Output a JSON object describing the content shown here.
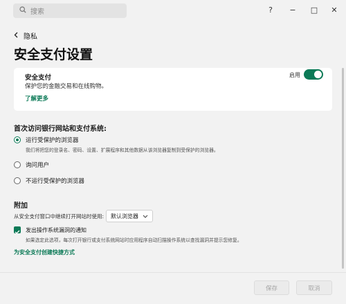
{
  "search": {
    "placeholder": "搜索"
  },
  "window": {
    "help": "?",
    "minimize": "−",
    "maximize": "□",
    "close": "✕"
  },
  "breadcrumb": {
    "back_label": "隐私"
  },
  "page": {
    "title": "安全支付设置"
  },
  "safe_payment_card": {
    "title": "安全支付",
    "description": "保护您的金融交易和在线购物。",
    "learn_more": "了解更多",
    "toggle_label": "启用",
    "enabled": true
  },
  "first_visit": {
    "title": "首次访问银行网站和支付系统:",
    "options": [
      {
        "label": "运行受保护的浏览器",
        "sub": "我们将把您的登录名、密码、设置、扩展程序和其他数据从该浏览器复制到受保护的浏览器。",
        "checked": true
      },
      {
        "label": "询问用户",
        "sub": "",
        "checked": false
      },
      {
        "label": "不运行受保护的浏览器",
        "sub": "",
        "checked": false
      }
    ]
  },
  "additional": {
    "title": "附加",
    "open_label": "从安全支付窗口中继续打开网站时使用:",
    "browser_value": "默认浏览器",
    "notify_label": "发出操作系统漏洞的通知",
    "notify_sub": "如果选定此选项，每次打开银行或支付系统网站时应用程序自动扫描操作系统以查找漏洞并提示您修复。",
    "notify_checked": true,
    "shortcut_link": "为安全支付创建快捷方式"
  },
  "footer": {
    "save": "保存",
    "cancel": "取消"
  },
  "colors": {
    "accent": "#0c7a57",
    "background": "#f2f2f2",
    "card": "#ffffff"
  }
}
